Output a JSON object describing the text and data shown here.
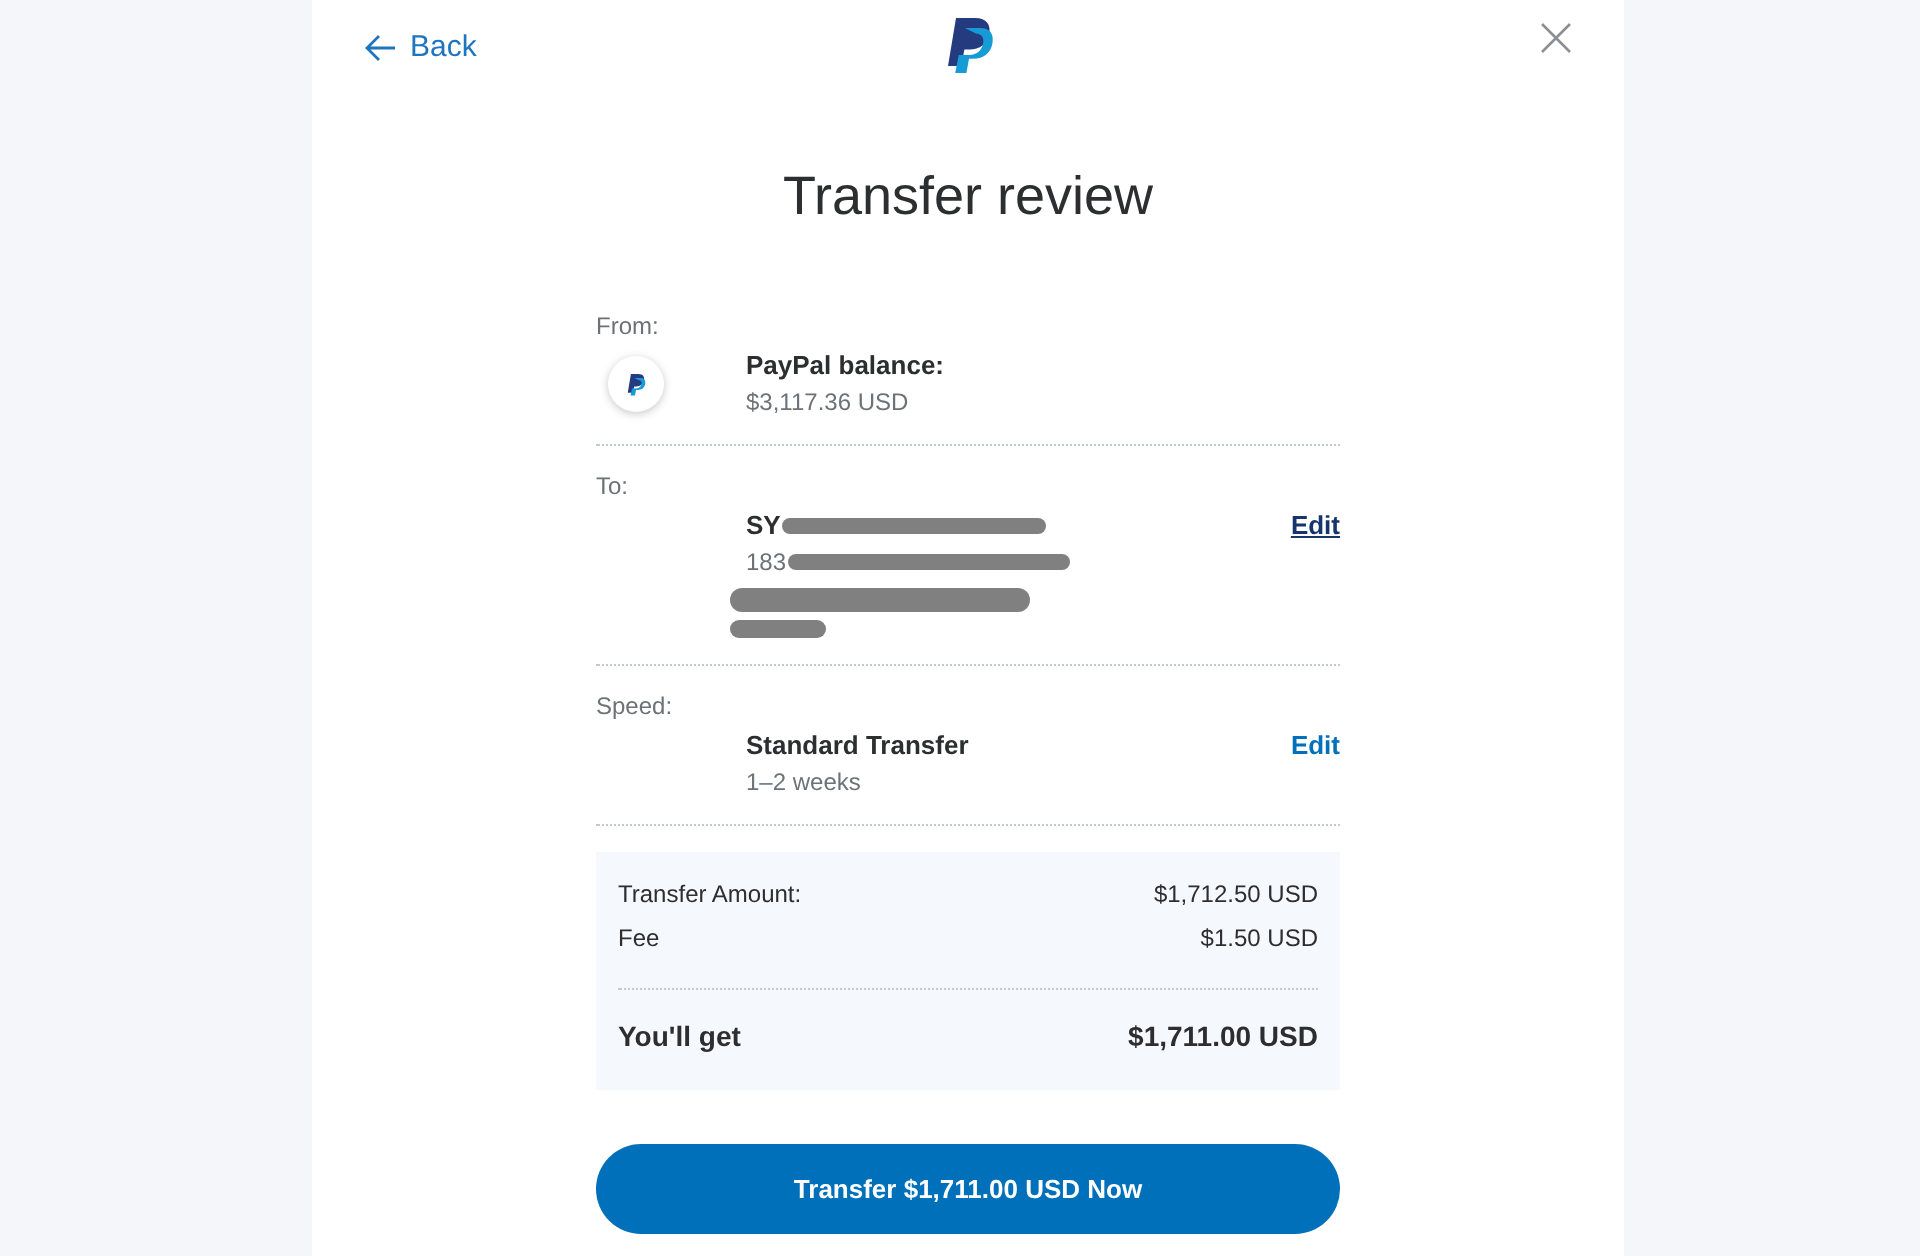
{
  "header": {
    "back": "Back"
  },
  "title": "Transfer review",
  "sections": [
    {
      "kind": "source",
      "label": "From:",
      "title": {
        "text": "PayPal balance:",
        "redacted": false
      },
      "lines": [
        {
          "text": "$3,117.36 USD",
          "redacted": false
        }
      ]
    },
    {
      "kind": "recipient",
      "label": "To:",
      "title": {
        "text": "SY",
        "redacted": true
      },
      "lines": [
        {
          "text": "183",
          "redacted": true
        },
        {
          "redacted": true
        },
        {
          "redacted": true
        }
      ],
      "edit": {
        "label": "Edit",
        "hovered": true
      }
    },
    {
      "kind": "speed",
      "label": "Speed:",
      "title": {
        "text": "Standard Transfer",
        "redacted": false
      },
      "lines": [
        {
          "text": "1–2 weeks",
          "redacted": false
        }
      ],
      "edit": {
        "label": "Edit",
        "hovered": false
      }
    }
  ],
  "summary": {
    "rows": [
      {
        "label": "Transfer Amount:",
        "value": "$1,712.50 USD"
      },
      {
        "label": "Fee",
        "value": "$1.50 USD"
      }
    ],
    "total": {
      "label": "You'll get",
      "value": "$1,711.00 USD"
    }
  },
  "submit": "Transfer $1,711.00 USD Now"
}
